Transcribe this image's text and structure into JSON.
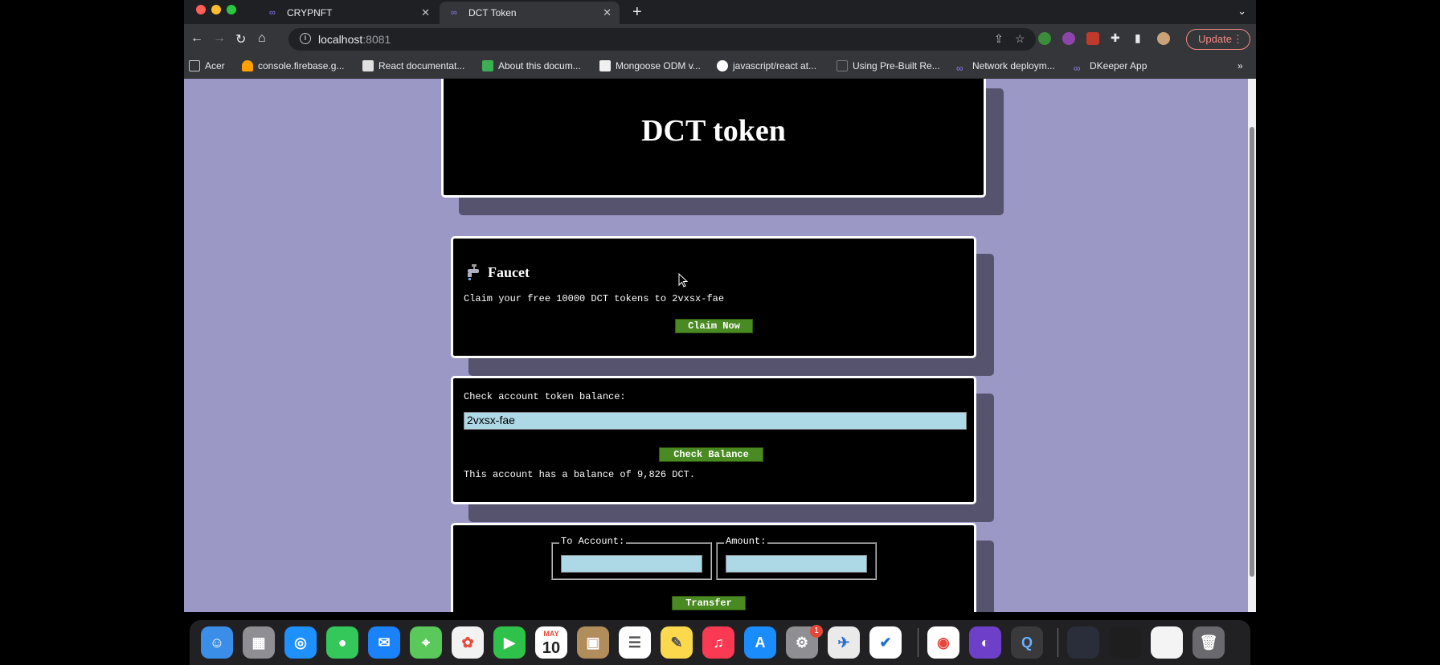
{
  "browser": {
    "tabs": [
      {
        "title": "CRYPNFT",
        "icon": "dfinity-icon"
      },
      {
        "title": "DCT Token",
        "icon": "dfinity-icon",
        "active": true
      }
    ],
    "url_host": "localhost",
    "url_port": ":8081",
    "update_label": "Update",
    "bookmarks": [
      {
        "label": "Acer",
        "icon": "folder-icon"
      },
      {
        "label": "console.firebase.g...",
        "icon": "firebase-icon"
      },
      {
        "label": "React documentat...",
        "icon": "react-icon"
      },
      {
        "label": "About this docum...",
        "icon": "cube-icon"
      },
      {
        "label": "Mongoose ODM v...",
        "icon": "mongoose-icon"
      },
      {
        "label": "javascript/react at...",
        "icon": "github-icon"
      },
      {
        "label": "Using Pre-Built Re...",
        "icon": "page-icon"
      },
      {
        "label": "Network deploym...",
        "icon": "dfinity-icon"
      },
      {
        "label": "DKeeper App",
        "icon": "dfinity-icon"
      }
    ]
  },
  "page": {
    "header_title": "DCT token",
    "faucet": {
      "icon": "faucet-icon",
      "title": "Faucet",
      "text": "Claim your free 10000 DCT tokens to 2vxsx-fae",
      "button_label": "Claim Now"
    },
    "balance": {
      "label": "Check account token balance:",
      "input_value": "2vxsx-fae",
      "button_label": "Check Balance",
      "result_text": "This account has a balance of 9,826 DCT."
    },
    "transfer": {
      "to_legend": "To Account:",
      "amount_legend": "Amount:",
      "button_label": "Transfer"
    }
  },
  "dock": {
    "calendar_month": "MAY",
    "calendar_day": "10",
    "settings_badge": "1"
  },
  "colors": {
    "page_background": "#9c98c6",
    "card_background": "#000000",
    "button_green": "#4a8a22",
    "input_background": "#add8e6"
  }
}
